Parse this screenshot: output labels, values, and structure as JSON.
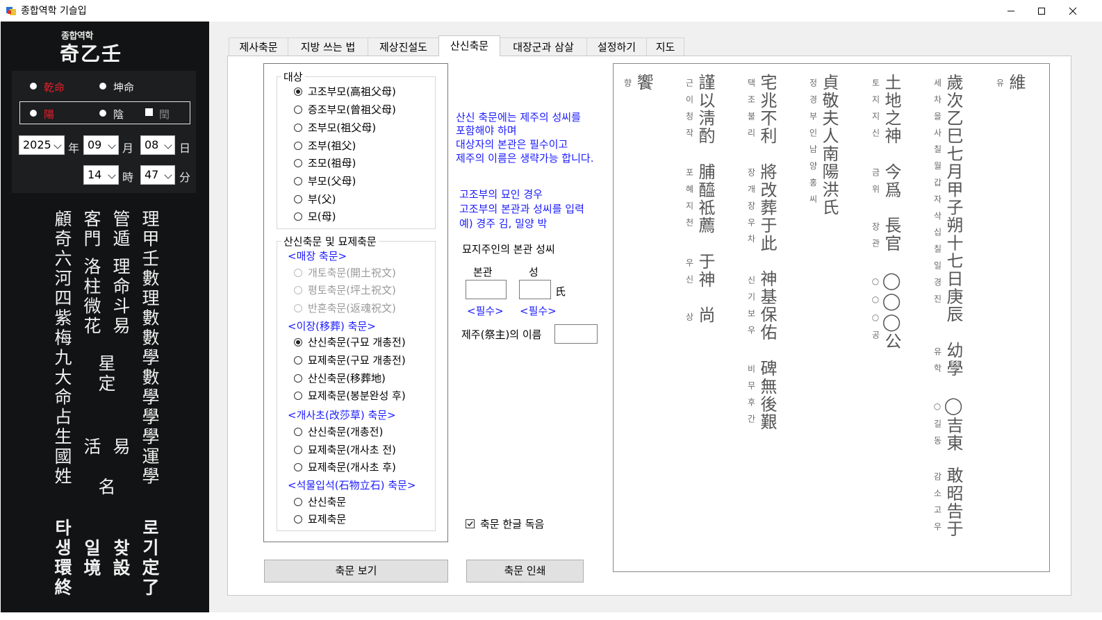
{
  "window": {
    "title": "종합역학 기슬입"
  },
  "sidebar": {
    "brand_small": "종합역학",
    "brand_big": "奇乙壬",
    "gender_male": "乾命",
    "gender_female": "坤命",
    "yang": "陽",
    "yin": "陰",
    "leap": "閏",
    "year": "2025",
    "year_label": "年",
    "month": "09",
    "month_label": "月",
    "day": "08",
    "day_label": "日",
    "hour": "14",
    "hour_label": "時",
    "minute": "47",
    "minute_label": "分",
    "columns": [
      "理甲壬數理數數學數學學學運學",
      "管遁 理命斗易",
      "客門 洛柱微花",
      "顧奇六河四紫梅九大命占生國姓"
    ],
    "col2_extra": [
      "星",
      "定",
      "活",
      "名"
    ],
    "col3_extra": "易",
    "bottom_col4": "로기定了",
    "bottom_col3": "찾設",
    "bottom_col2": "일境",
    "bottom_col1": "타생環終"
  },
  "tabs": [
    "제사축문",
    "지방 쓰는 법",
    "제상진설도",
    "산신축문",
    "대장군과 삼살",
    "설정하기",
    "지도"
  ],
  "target_group": {
    "legend": "대상",
    "options": [
      "고조부모(高祖父母)",
      "증조부모(曾祖父母)",
      "조부모(祖父母)",
      "조부(祖父)",
      "조모(祖母)",
      "부모(父母)",
      "부(父)",
      "모(母)"
    ]
  },
  "prayer_group": {
    "legend": "산신축문 및 묘제축문",
    "sec1": "<매장 축문>",
    "sec1_options": [
      "개토축문(開土祝文)",
      "평토축문(坪土祝文)",
      "반혼축문(返魂祝文)"
    ],
    "sec2": "<이장(移葬) 축문>",
    "sec2_options": [
      "산신축문(구묘 개총전)",
      "묘제축문(구묘 개총전)",
      "산신축문(移葬地)",
      "묘제축문(봉분완성 후)"
    ],
    "sec3": "<개사초(改莎草) 축문>",
    "sec3_options": [
      "산신축문(개총전)",
      "묘제축문(개사초 전)",
      "묘제축문(개사초 후)"
    ],
    "sec4": "<석물입석(石物立石) 축문>",
    "sec4_options": [
      "산신축문",
      "묘제축문"
    ]
  },
  "notes": {
    "note1": [
      "산신 축문에는 제주의 성씨를",
      "포함해야 하며",
      "대상자의 본관은 필수이고",
      "제주의 이름은 생략가능 합니다."
    ],
    "note2": [
      "고조부의 묘인 경우",
      "고조부의 본관과 성씨를 입력",
      "예) 경주 김, 밀양 박"
    ]
  },
  "form": {
    "owner_label": "묘지주인의 본관 성씨",
    "bongwan_label": "본관",
    "surname_label": "성",
    "surname_suffix": "氏",
    "required1": "<필수>",
    "required2": "<필수>",
    "jeju_label": "제주(祭主)의 이름",
    "hangul_read": "축문 한글 독음",
    "view_button": "축문 보기",
    "print_button": "축문 인쇄"
  },
  "document": {
    "columns": [
      {
        "small": "유",
        "big": "維"
      },
      {
        "small": "세차을사칠월갑자삭십칠일경진",
        "big": "歲次乙巳七月甲子朔十七日庚辰",
        "small2": "유학",
        "big2": "幼學",
        "small3": "○길동",
        "big3": "◯吉東",
        "small4": "감소고우",
        "big4": "敢昭告于"
      },
      {
        "small": "토지지신",
        "big": "土地之神",
        "small2": "금위",
        "big2": "今爲",
        "small3": "장관",
        "big3": "長官",
        "small4": "○○○공",
        "big4": "◯◯◯公"
      },
      {
        "small": "정경부인남양홍씨",
        "big": "貞敬夫人南陽洪氏"
      },
      {
        "small": "택조불리",
        "big": "宅兆不利",
        "small2": "장개장우차",
        "big2": "將改葬于此",
        "small3": "신기보우",
        "big3": "神基保佑",
        "small4": "비무후간",
        "big4": "碑無後艱"
      },
      {
        "small": "근이청작",
        "big": "謹以淸酌",
        "small2": "포혜지천",
        "big2": "脯醯祗薦",
        "small3": "우신",
        "big3": "于神",
        "small4": "상",
        "big4": "尚"
      },
      {
        "small": "향",
        "big": "饗"
      }
    ]
  }
}
